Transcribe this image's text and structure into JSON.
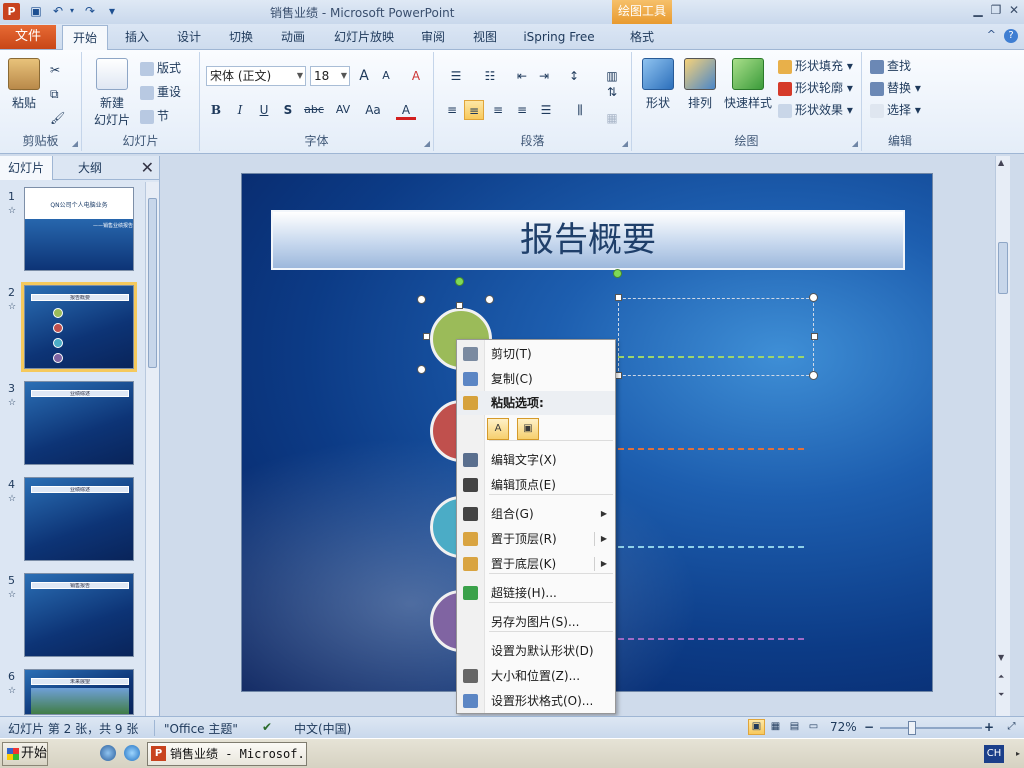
{
  "window": {
    "title": "销售业绩 - Microsoft PowerPoint",
    "context_tab_group": "绘图工具",
    "app_icon_letter": "P",
    "minimize": "▁",
    "restore": "❐",
    "close": "✕"
  },
  "quick_access": {
    "save": "▣",
    "undo": "↶",
    "redo": "↷",
    "customize": "▾"
  },
  "tabs": {
    "file": "文件",
    "items": [
      "开始",
      "插入",
      "设计",
      "切换",
      "动画",
      "幻灯片放映",
      "审阅",
      "视图",
      "iSpring Free",
      "格式"
    ],
    "help": "?",
    "minimize_ribbon": "^"
  },
  "ribbon": {
    "clipboard": {
      "label": "剪贴板",
      "paste": "粘贴",
      "cut": "✂",
      "copy": "⧉",
      "format_painter": "🖌"
    },
    "slides": {
      "label": "幻灯片",
      "new_slide_line1": "新建",
      "new_slide_line2": "幻灯片",
      "layout": "版式",
      "reset": "重设",
      "section": "节"
    },
    "font": {
      "label": "字体",
      "font_name": "宋体 (正文)",
      "font_size": "18",
      "grow": "A",
      "shrink": "A",
      "clear": "A",
      "bold": "B",
      "italic": "I",
      "underline": "U",
      "shadow": "S",
      "strike": "abc",
      "spacing": "AV",
      "case": "Aa",
      "color": "A"
    },
    "paragraph": {
      "label": "段落"
    },
    "drawing": {
      "label": "绘图",
      "shapes": "形状",
      "arrange": "排列",
      "quick_styles": "快速样式",
      "fill": "形状填充",
      "outline": "形状轮廓",
      "effects": "形状效果"
    },
    "editing": {
      "label": "编辑",
      "find": "查找",
      "replace": "替换",
      "select": "选择"
    }
  },
  "slide_pane": {
    "tabs": [
      "幻灯片",
      "大纲"
    ],
    "close": "✕",
    "thumbnails": [
      {
        "num": "1",
        "title": "QN公司个人电脑业务",
        "subtitle": "——销售业绩报告"
      },
      {
        "num": "2",
        "title": "报告概要"
      },
      {
        "num": "3",
        "title": "业绩综述"
      },
      {
        "num": "4",
        "title": "业绩综述"
      },
      {
        "num": "5",
        "title": "销售报告"
      },
      {
        "num": "6",
        "title": "未来展望"
      }
    ],
    "star": "☆"
  },
  "slide": {
    "title": "报告概要",
    "circle_colors": [
      "#9bbb59",
      "#c0504d",
      "#4bacc6",
      "#8064a2"
    ],
    "dash_colors": [
      "#9bd66b",
      "#e0703c",
      "#8fd0e8",
      "#a06bc7"
    ]
  },
  "context_menu": {
    "items": [
      {
        "label": "剪切(T)",
        "icon": "scissors-icon",
        "color": "#7a8aa0"
      },
      {
        "label": "复制(C)",
        "icon": "copy-icon",
        "color": "#5c86c4"
      },
      {
        "label": "粘贴选项:",
        "icon": "paste-icon",
        "color": "#d6a23c"
      },
      {
        "label": "编辑文字(X)",
        "icon": "edit-text-icon",
        "color": "#5a6f8e"
      },
      {
        "label": "编辑顶点(E)",
        "icon": "edit-points-icon",
        "color": "#444"
      },
      {
        "label": "组合(G)",
        "icon": "group-icon",
        "color": "#444"
      },
      {
        "label": "置于顶层(R)",
        "icon": "bring-front-icon",
        "color": "#d9a441"
      },
      {
        "label": "置于底层(K)",
        "icon": "send-back-icon",
        "color": "#d9a441"
      },
      {
        "label": "超链接(H)...",
        "icon": "hyperlink-icon",
        "color": "#3aa14a"
      },
      {
        "label": "另存为图片(S)...",
        "icon": "",
        "color": ""
      },
      {
        "label": "设置为默认形状(D)",
        "icon": "",
        "color": ""
      },
      {
        "label": "大小和位置(Z)...",
        "icon": "size-position-icon",
        "color": "#666"
      },
      {
        "label": "设置形状格式(O)...",
        "icon": "format-shape-icon",
        "color": "#5c86c4"
      }
    ],
    "paste_options": [
      "A",
      "▣"
    ]
  },
  "statusbar": {
    "slide_info": "幻灯片 第 2 张，共 9 张",
    "theme": "\"Office 主题\"",
    "language": "中文(中国)",
    "zoom": "72%",
    "zoom_out": "−",
    "zoom_in": "+",
    "zoom_level": 0.3
  },
  "taskbar": {
    "start": "开始",
    "ppt_task": "销售业绩 - Microsof...",
    "ime": "CH"
  }
}
